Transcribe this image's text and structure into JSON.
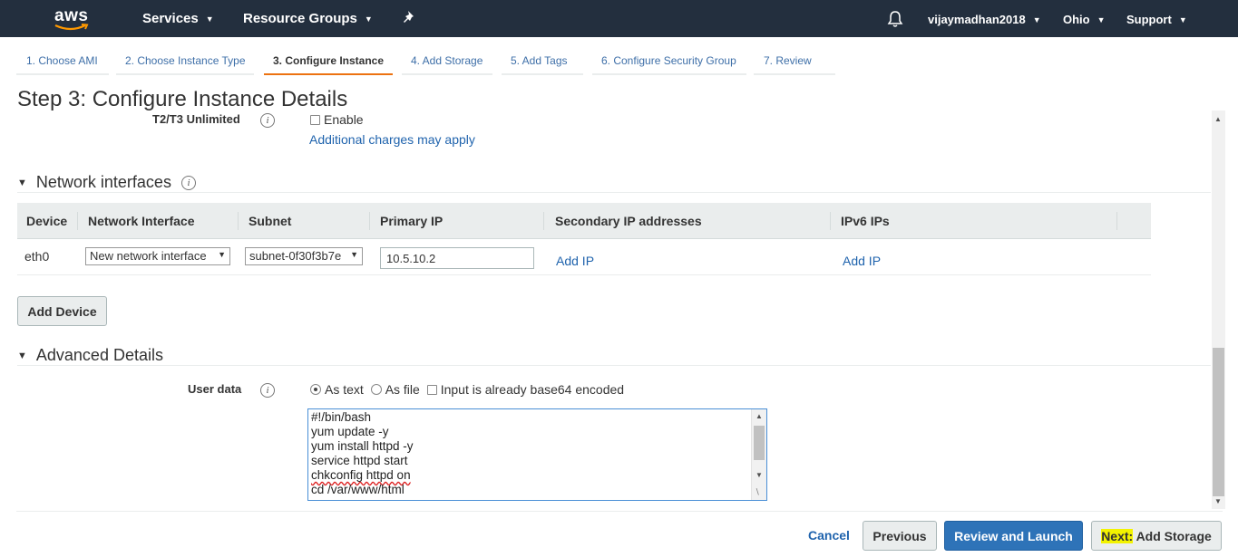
{
  "topnav": {
    "logo_text": "aws",
    "services": "Services",
    "resource_groups": "Resource Groups",
    "account": "vijaymadhan2018",
    "region": "Ohio",
    "support": "Support"
  },
  "wizard": {
    "tabs": [
      {
        "label": "1. Choose AMI"
      },
      {
        "label": "2. Choose Instance Type"
      },
      {
        "label": "3. Configure Instance"
      },
      {
        "label": "4. Add Storage"
      },
      {
        "label": "5. Add Tags"
      },
      {
        "label": "6. Configure Security Group"
      },
      {
        "label": "7. Review"
      }
    ],
    "active_index": 2
  },
  "page": {
    "title": "Step 3: Configure Instance Details"
  },
  "unlimited": {
    "label": "T2/T3 Unlimited",
    "checkbox_label": "Enable",
    "charges_link": "Additional charges may apply"
  },
  "network": {
    "section_title": "Network interfaces",
    "columns": [
      "Device",
      "Network Interface",
      "Subnet",
      "Primary IP",
      "Secondary IP addresses",
      "IPv6 IPs"
    ],
    "row": {
      "device": "eth0",
      "interface": "New network interface",
      "subnet": "subnet-0f30f3b7e",
      "primary_ip": "10.5.10.2",
      "secondary_add": "Add IP",
      "ipv6_add": "Add IP"
    },
    "add_device": "Add Device"
  },
  "advanced": {
    "section_title": "Advanced Details",
    "user_data_label": "User data",
    "as_text": "As text",
    "as_file": "As file",
    "base64": "Input is already base64 encoded",
    "script_lines": [
      "#!/bin/bash",
      "yum update -y",
      "yum install httpd -y",
      "service httpd start",
      "chkconfig httpd on",
      "cd /var/www/html"
    ]
  },
  "footer": {
    "cancel": "Cancel",
    "previous": "Previous",
    "review_launch": "Review and Launch",
    "next_prefix": "Next:",
    "next_suffix": " Add Storage"
  },
  "colors": {
    "navbar": "#232f3e",
    "link": "#1f63ad",
    "active_tab": "#ec7211",
    "primary_button": "#2e73b8"
  }
}
